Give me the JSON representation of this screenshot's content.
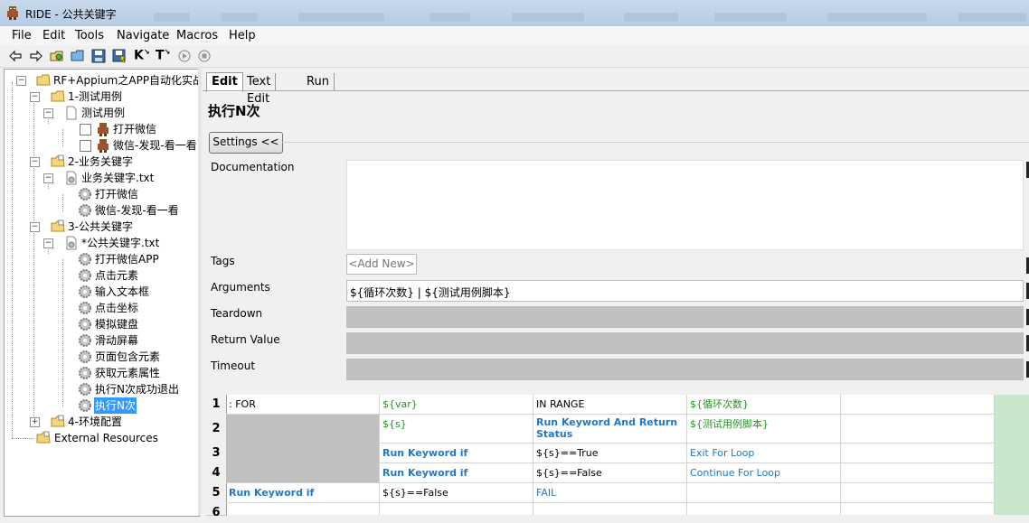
{
  "window": {
    "title": "RIDE - 公共关键字"
  },
  "menu": [
    "File",
    "Edit",
    "Tools",
    "Navigate",
    "Macros",
    "Help"
  ],
  "toolbar": {
    "icons": [
      "back-arrow-icon",
      "forward-arrow-icon",
      "open-test-suite-icon",
      "open-directory-icon",
      "save-icon",
      "save-all-icon",
      "search-keywords-icon",
      "search-tests-icon",
      "run-icon",
      "stop-icon"
    ],
    "k_label": "K",
    "t_label": "T"
  },
  "tree": {
    "root": "RF+Appium之APP自动化实战",
    "n1": "1-测试用例",
    "n1_file": "测试用例",
    "n1_t1": "打开微信",
    "n1_t2": "微信-发现-看一看",
    "n2": "2-业务关键字",
    "n2_file": "业务关键字.txt",
    "n2_k1": "打开微信",
    "n2_k2": "微信-发现-看一看",
    "n3": "3-公共关键字",
    "n3_file": "*公共关键字.txt",
    "n3_k1": "打开微信APP",
    "n3_k2": "点击元素",
    "n3_k3": "输入文本框",
    "n3_k4": "点击坐标",
    "n3_k5": "模拟键盘",
    "n3_k6": "滑动屏幕",
    "n3_k7": "页面包含元素",
    "n3_k8": "获取元素属性",
    "n3_k9": "执行N次成功退出",
    "n3_k10": "执行N次",
    "n4": "4-环境配置",
    "ext": "External Resources",
    "expander_minus": "−",
    "expander_plus": "+"
  },
  "editor": {
    "tabs": [
      "Edit",
      "Text Edit",
      "Run"
    ],
    "keyword_name": "执行N次",
    "settings_button": "Settings <<",
    "labels": {
      "documentation": "Documentation",
      "tags": "Tags",
      "arguments": "Arguments",
      "teardown": "Teardown",
      "return_value": "Return Value",
      "timeout": "Timeout"
    },
    "tags_placeholder": "<Add New>",
    "arguments_value": "${循环次数}  | ${测试用例脚本}"
  },
  "grid": {
    "row_numbers": [
      "1",
      "2",
      "3",
      "4",
      "5",
      "6"
    ],
    "r1": [
      ": FOR",
      "${var}",
      "IN RANGE",
      "${循环次数}"
    ],
    "r2": [
      "",
      "${s}",
      "Run Keyword And Return Status",
      "${测试用例脚本}"
    ],
    "r3": [
      "",
      "Run Keyword if",
      "${s}==True",
      "Exit For Loop"
    ],
    "r4": [
      "",
      "Run Keyword if",
      "${s}==False",
      "Continue For Loop"
    ],
    "r5": [
      "Run Keyword if",
      "${s}==False",
      "FAIL",
      ""
    ]
  },
  "colors": {
    "keyword_blue": "#1f78c8",
    "variable_green": "#2a8e2a",
    "selection_blue": "#3399ff",
    "disabled_gray": "#c0c0c0"
  }
}
